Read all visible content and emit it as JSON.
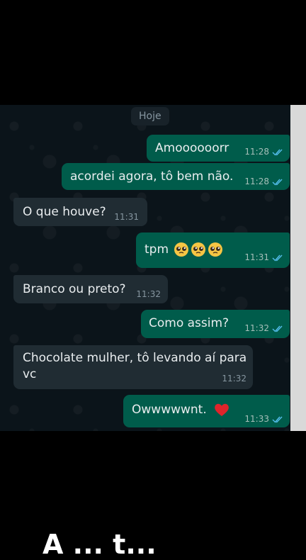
{
  "date_chip": "Hoje",
  "messages": [
    {
      "dir": "out",
      "text": "Amoooooorr",
      "time": "11:28",
      "read": true
    },
    {
      "dir": "out",
      "text": "acordei agora, tô bem não.",
      "time": "11:28",
      "read": true
    },
    {
      "dir": "in",
      "text": "O que houve?",
      "time": "11:31"
    },
    {
      "dir": "out",
      "text": "tpm",
      "emojis": [
        "pleading-face-emoji",
        "pleading-face-emoji",
        "pleading-face-emoji"
      ],
      "time": "11:31",
      "read": true
    },
    {
      "dir": "in",
      "text": "Branco ou preto?",
      "time": "11:32"
    },
    {
      "dir": "out",
      "text": "Como assim?",
      "time": "11:32",
      "read": true
    },
    {
      "dir": "in",
      "text_line1": "Chocolate mulher, tô levando aí para",
      "text_line2": "vc",
      "time": "11:32"
    },
    {
      "dir": "out",
      "text": "Owwwwwnt.",
      "emoji": "red-heart-emoji",
      "time": "11:33",
      "read": true
    }
  ],
  "caption": "A ... t...",
  "colors": {
    "chat_bg": "#0b141a",
    "outgoing_bubble": "#005c4b",
    "incoming_bubble": "#202c33",
    "read_ticks": "#53bdeb"
  }
}
